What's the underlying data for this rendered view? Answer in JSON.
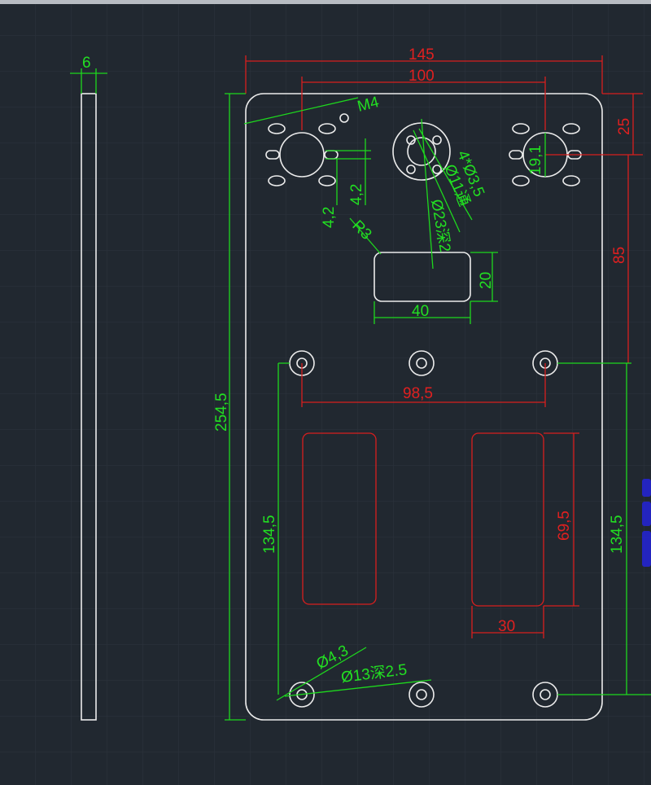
{
  "colors": {
    "background": "#212830",
    "outline": "#ececec",
    "dimension_red": "#e02020",
    "dimension_green": "#22e022",
    "annotation_blue": "#2020e0"
  },
  "side_view": {
    "thickness": "6"
  },
  "dims": {
    "overall_width": "145",
    "hole_spacing_top": "100",
    "top_offset": "25",
    "vertical_85": "85",
    "overall_height": "254,5",
    "hole_diameter_19": "19,1",
    "slot_offset_a": "4,2",
    "slot_offset_b": "4,2",
    "m4": "M4",
    "radius": "R3",
    "holes_4x": "4*Ø3,5",
    "through_hole": "Ø11通",
    "counterbore": "Ø23深2",
    "slot_height": "20",
    "slot_width": "40",
    "mount_spacing": "98,5",
    "left_vertical": "134,5",
    "right_vertical": "134,5",
    "window_height": "69,5",
    "window_width": "30",
    "mount_hole": "Ø4,3",
    "mount_counterbore": "Ø13深2.5"
  }
}
